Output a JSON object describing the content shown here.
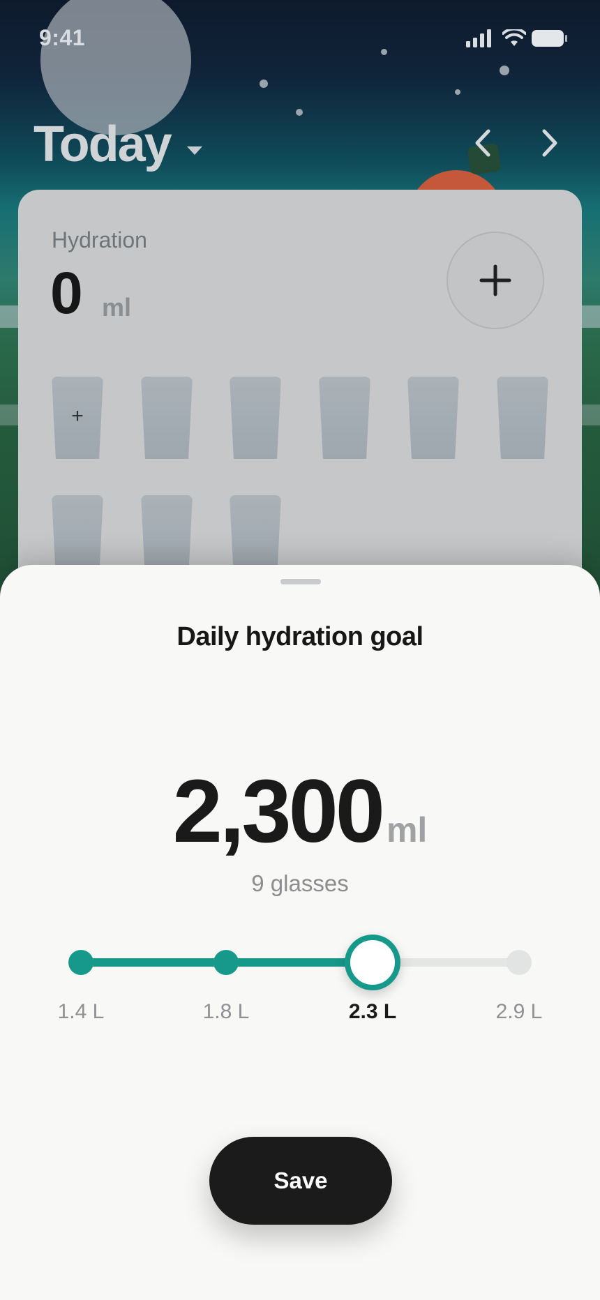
{
  "status_bar": {
    "time": "9:41"
  },
  "header": {
    "title": "Today"
  },
  "card": {
    "label": "Hydration",
    "value": "0",
    "unit": "ml",
    "glass_add_symbol": "+",
    "add_button_symbol": "+"
  },
  "goal_sheet": {
    "title": "Daily hydration goal",
    "value": "2,300",
    "unit": "ml",
    "glasses_text": "9 glasses",
    "steps": [
      {
        "label": "1.4 L"
      },
      {
        "label": "1.8 L"
      },
      {
        "label": "2.3 L"
      },
      {
        "label": "2.9 L"
      }
    ],
    "selected_step_index": 2,
    "save_label": "Save"
  },
  "colors": {
    "accent": "#16998a",
    "save_button": "#1b1b1c",
    "sheet_background": "#f8f8f6"
  },
  "icons": {
    "date_dropdown": "caret-down-icon",
    "prev": "chevron-left-icon",
    "next": "chevron-right-icon",
    "add": "plus-icon"
  }
}
